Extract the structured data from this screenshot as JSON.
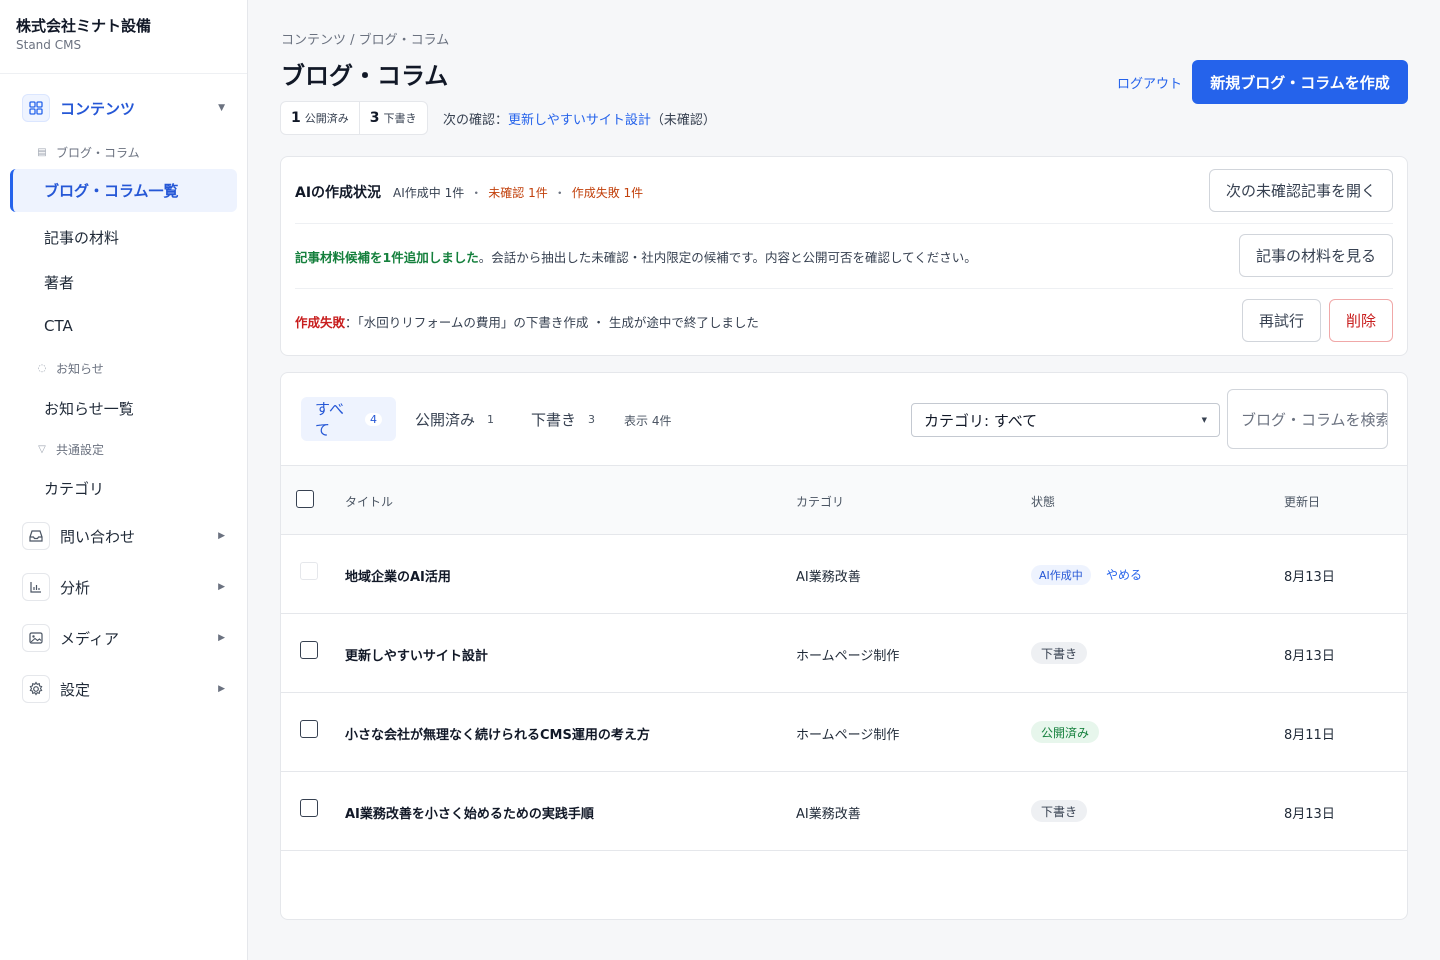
{
  "brand": {
    "name": "株式会社ミナト設備",
    "sub": "Stand CMS"
  },
  "sidebar": {
    "contents": {
      "label": "コンテンツ",
      "icon": "grid-icon"
    },
    "blog_section": "ブログ・コラム",
    "blog_items": [
      "ブログ・コラム一覧",
      "記事の材料",
      "著者",
      "CTA"
    ],
    "news_section": "お知らせ",
    "news_items": [
      "お知らせ一覧"
    ],
    "common_section": "共通設定",
    "common_items": [
      "カテゴリ"
    ],
    "groups": [
      {
        "label": "問い合わせ",
        "icon": "inbox-icon"
      },
      {
        "label": "分析",
        "icon": "chart-icon"
      },
      {
        "label": "メディア",
        "icon": "image-icon"
      },
      {
        "label": "設定",
        "icon": "gear-icon"
      }
    ]
  },
  "header": {
    "breadcrumb": "コンテンツ / ブログ・コラム",
    "title": "ブログ・コラム",
    "published_count": "1",
    "published_label": "公開済み",
    "draft_count": "3",
    "draft_label": "下書き",
    "next_check_label": "次の確認：",
    "next_check_link": "更新しやすいサイト設計",
    "next_check_suffix": "（未確認）",
    "logout": "ログアウト",
    "create_button": "新規ブログ・コラムを作成"
  },
  "ai_status": {
    "title": "AIの作成状況",
    "in_progress": "AI作成中 1件",
    "separator": "・",
    "unconfirmed": "未確認 1件",
    "failed": "作成失敗 1件",
    "open_next_button": "次の未確認記事を開く",
    "material_msg_strong": "記事材料候補を1件追加しました",
    "material_msg_rest": "。会話から抽出した未確認・社内限定の候補です。内容と公開可否を確認してください。",
    "material_button": "記事の材料を見る",
    "fail_label": "作成失敗",
    "fail_msg": "：「水回りリフォームの費用」の下書き作成 ・ 生成が途中で終了しました",
    "retry_button": "再試行",
    "delete_button": "削除"
  },
  "list": {
    "tabs": [
      {
        "label": "すべて",
        "count": "4"
      },
      {
        "label": "公開済み",
        "count": "1"
      },
      {
        "label": "下書き",
        "count": "3"
      }
    ],
    "shown": "表示 4件",
    "category_select": "カテゴリ: すべて",
    "search_placeholder": "ブログ・コラムを検索",
    "columns": {
      "title": "タイトル",
      "category": "カテゴリ",
      "status": "状態",
      "updated": "更新日"
    },
    "rows": [
      {
        "title": "地域企業のAI活用",
        "category": "AI業務改善",
        "status": "AI作成中",
        "action": "やめる",
        "updated": "8月13日"
      },
      {
        "title": "更新しやすいサイト設計",
        "category": "ホームページ制作",
        "status": "下書き",
        "updated": "8月13日"
      },
      {
        "title": "小さな会社が無理なく続けられるCMS運用の考え方",
        "category": "ホームページ制作",
        "status": "公開済み",
        "updated": "8月11日"
      },
      {
        "title": "AI業務改善を小さく始めるための実践手順",
        "category": "AI業務改善",
        "status": "下書き",
        "updated": "8月13日"
      }
    ]
  },
  "colors": {
    "accent": "#2563eb",
    "danger": "#c81e1e",
    "success": "#15803d"
  }
}
